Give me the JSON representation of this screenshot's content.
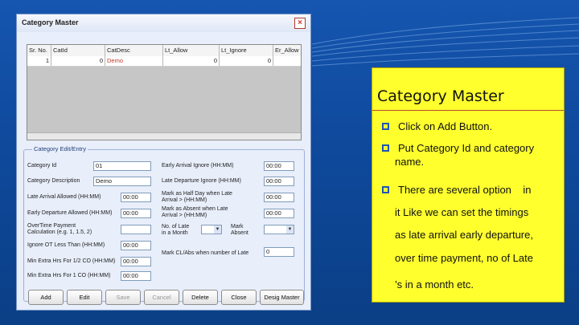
{
  "window": {
    "title": "Category Master",
    "close_glyph": "×"
  },
  "grid": {
    "headers": [
      "Sr. No.",
      "CatId",
      "CatDesc",
      "Lt_Allow",
      "Lt_Ignore",
      "Er_Allow"
    ],
    "row": [
      "1",
      "0",
      "Demo",
      "0",
      "0",
      ""
    ]
  },
  "edit_group": {
    "title": "Category Edit/Entry",
    "left": [
      {
        "label": "Category Id",
        "value": "01"
      },
      {
        "label": "Category Description",
        "value": "Demo"
      },
      {
        "label": "Late Arrival Allowed (HH:MM)",
        "value": "00:00"
      },
      {
        "label": "Early Departure Allowed (HH:MM)",
        "value": "00:00"
      },
      {
        "label1": "OverTime Payment",
        "label2": "Calculation (e.g. 1, 1.5, 2)",
        "value": ""
      },
      {
        "label": "Ignore OT Less Than (HH:MM)",
        "value": "00:00"
      },
      {
        "label": "Min Extra Hrs For 1/2 CO (HH:MM)",
        "value": "00:00"
      },
      {
        "label": "Min Extra Hrs For 1 CO (HH:MM)",
        "value": "00:00"
      }
    ],
    "right": [
      {
        "label": "Early Arrival Ignore (HH:MM)",
        "value": "00:00"
      },
      {
        "label": "Late Departure Ignore (HH:MM)",
        "value": "00:00"
      },
      {
        "label1": "Mark as Half Day when Late",
        "label2": "Arrival > (HH:MM)",
        "value": "00:00"
      },
      {
        "label1": "Mark as Absent when Late",
        "label2": "Arrival > (HH:MM)",
        "value": "00:00"
      },
      {
        "label1": "No. of Late",
        "label2": "in a Month",
        "mid1": "Mark",
        "mid2": "Absent"
      },
      {
        "label": "Mark CL/Abs when number of Late",
        "value": "0"
      }
    ]
  },
  "buttons": [
    {
      "label": "Add",
      "enabled": true
    },
    {
      "label": "Edit",
      "enabled": true
    },
    {
      "label": "Save",
      "enabled": false
    },
    {
      "label": "Cancel",
      "enabled": false
    },
    {
      "label": "Delete",
      "enabled": true
    },
    {
      "label": "Close",
      "enabled": true
    },
    {
      "label": "Desig Master",
      "enabled": true
    }
  ],
  "panel": {
    "title": "Category Master",
    "bullets": [
      "Click on Add Button.",
      "Put Category Id and category",
      "There are several option    in"
    ],
    "continuations": [
      "name.",
      "it Like we can set the timings",
      "as late arrival early departure,",
      "over time payment, no of Late",
      "’s in a month etc."
    ],
    "bullet_color": "#1f56b3",
    "background": "#ffff2e"
  }
}
